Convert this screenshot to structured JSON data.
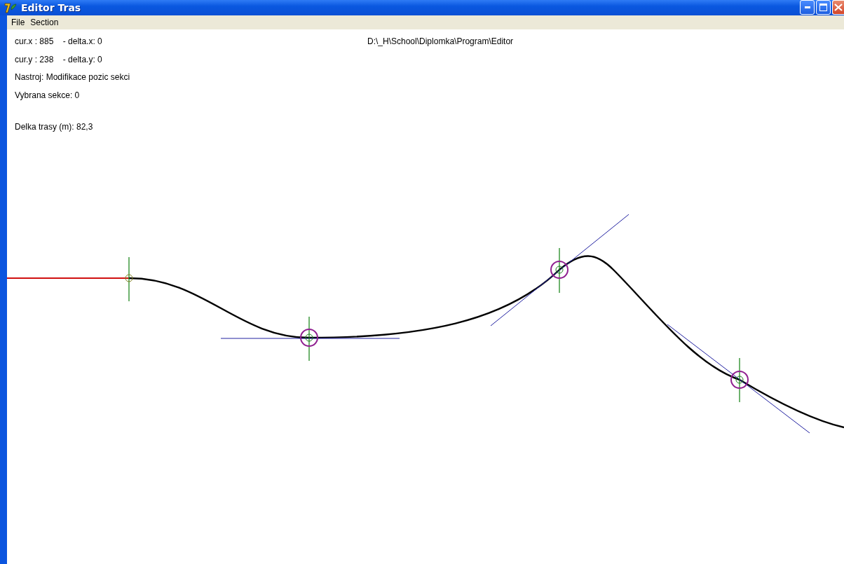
{
  "window": {
    "title": "Editor Tras"
  },
  "menu": [
    {
      "label": "File"
    },
    {
      "label": "Section"
    }
  ],
  "info_lines": [
    "cur.x : 885    - delta.x: 0",
    "cur.y : 238    - delta.y: 0",
    "Nastroj: Modifikace pozic sekci",
    "Vybrana sekce: 0"
  ],
  "track_length": "Delka trasy (m): 82,3",
  "path": "D:\\_H\\School\\Diplomka\\Program\\Editor"
}
